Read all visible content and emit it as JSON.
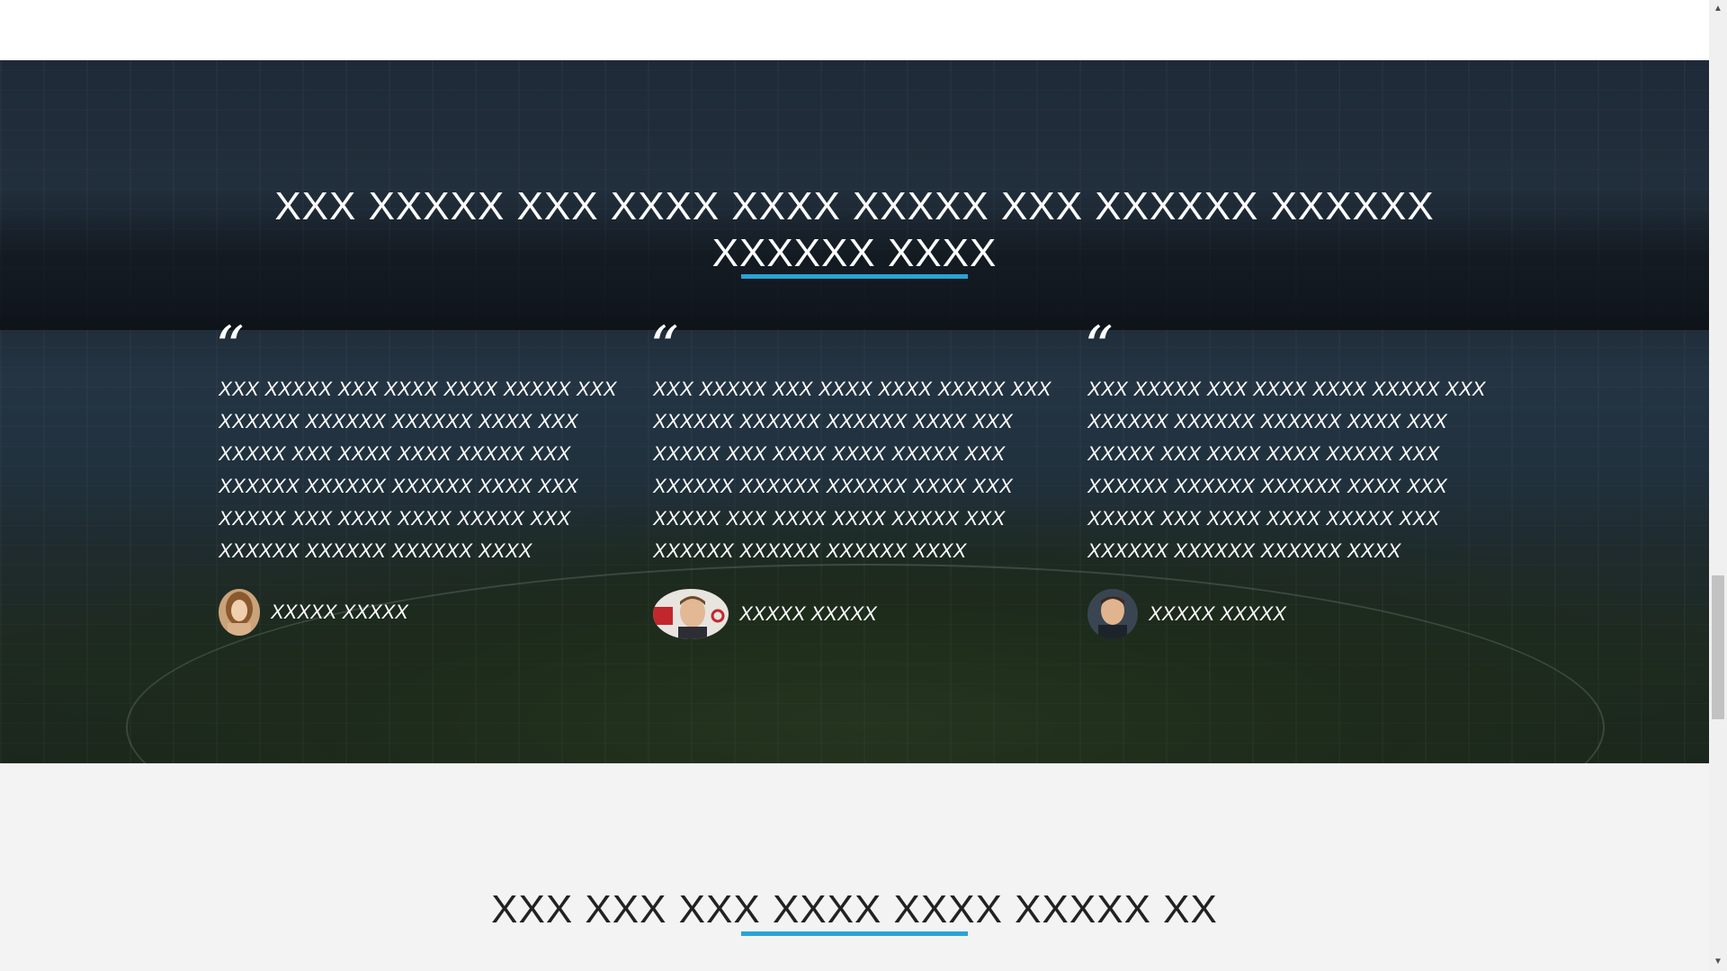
{
  "testimonials_section": {
    "title": "XXX XXXXX XXX XXXX XXXX XXXXX XXX XXXXXX XXXXXX XXXXXX XXXX",
    "items": [
      {
        "quote_mark": "“",
        "text": "XXX XXXXX XXX XXXX XXXX XXXXX XXX XXXXXX XXXXXX XXXXXX XXXX XXX XXXXX XXX XXXX XXXX XXXXX XXX XXXXXX XXXXXX XXXXXX XXXX XXX XXXXX XXX XXXX XXXX XXXXX XXX XXXXXX XXXXXX XXXXXX XXXX",
        "author": "XXXXX XXXXX",
        "avatar_icon": "avatar-woman-photo"
      },
      {
        "quote_mark": "“",
        "text": "XXX XXXXX XXX XXXX XXXX XXXXX XXX XXXXXX XXXXXX XXXXXX XXXX XXX XXXXX XXX XXXX XXXX XXXXX XXX XXXXXX XXXXXX XXXXXX XXXX XXX XXXXX XXX XXXX XXXX XXXXX XXX XXXXXX XXXXXX XXXXXX XXXX",
        "author": "XXXXX XXXXX",
        "avatar_icon": "avatar-man-photo"
      },
      {
        "quote_mark": "“",
        "text": "XXX XXXXX XXX XXXX XXXX XXXXX XXX XXXXXX XXXXXX XXXXXX XXXX XXX XXXXX XXX XXXX XXXX XXXXX XXX XXXXXX XXXXXX XXXXXX XXXX XXX XXXXX XXX XXXX XXXX XXXXX XXX XXXXXX XXXXXX XXXXXX XXXX",
        "author": "XXXXX XXXXX",
        "avatar_icon": "avatar-man-photo"
      }
    ]
  },
  "next_section": {
    "title": "XXX XXX XXX XXXX XXXX XXXXX XX"
  },
  "scrollbar": {
    "up_icon": "chevron-up-icon",
    "down_icon": "chevron-down-icon"
  },
  "colors": {
    "accent": "#2aa3d6",
    "hero_overlay": "#1a2330",
    "section_background": "#f3f3f3",
    "heading_dark": "#222222"
  }
}
